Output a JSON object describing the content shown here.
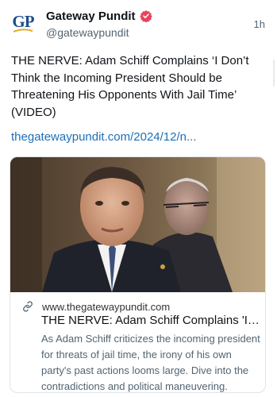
{
  "author": {
    "display_name": "Gateway Pundit",
    "handle": "@gatewaypundit",
    "avatar_text": "GP",
    "verified_icon": "verified-badge-icon",
    "verified_color": "#e8435e"
  },
  "post": {
    "timestamp": "1h",
    "text": "THE NERVE: Adam Schiff Complains ‘I Don’t Think the Incoming President Should be Threatening His Opponents With Jail Time’ (VIDEO)",
    "link_text": "thegatewaypundit.com/2024/12/n..."
  },
  "card": {
    "link_icon": "link-icon",
    "domain": "www.thegatewaypundit.com",
    "title": "THE NERVE: Adam Schiff Complains 'I Don’t Think the Incoming President Should be Threatening His Opponents With Jail Time' (VIDEO)",
    "description": "As Adam Schiff criticizes the incoming president for threats of jail time, the irony of his own party's past actions looms large. Dive into the contradictions and political maneuvering."
  },
  "colors": {
    "link": "#1d6fb8",
    "secondary_text": "#536471",
    "brand": "#1c4e8d"
  }
}
